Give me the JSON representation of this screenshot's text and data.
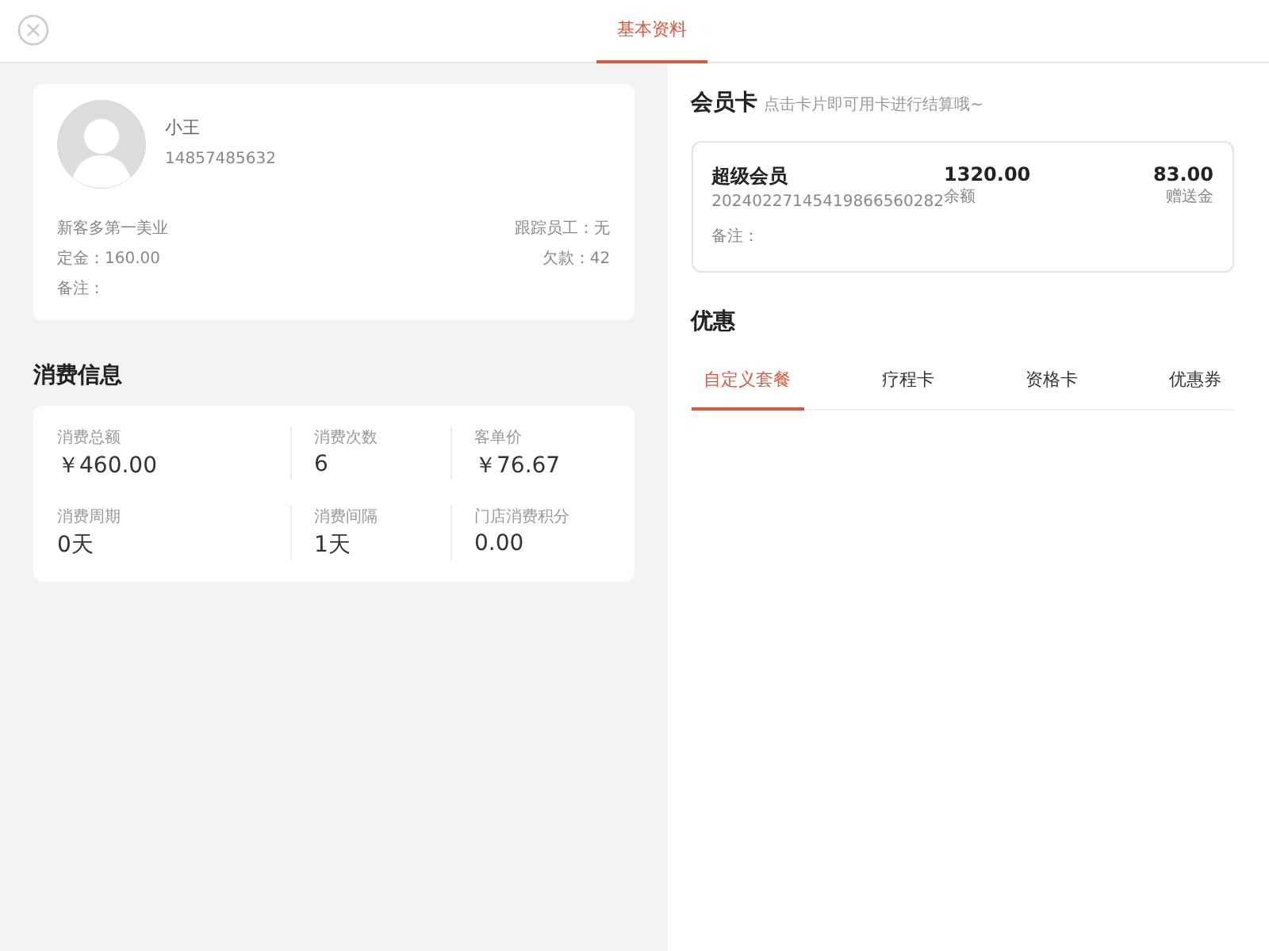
{
  "header": {
    "tabs": [
      {
        "label": "基本资料",
        "selected": true
      }
    ]
  },
  "profile": {
    "name": "小王",
    "phone": "14857485632",
    "store": "新客多第一美业",
    "staff": "跟踪员工：无",
    "deposit": "定金：160.00",
    "debt": "欠款：42",
    "note": "备注："
  },
  "consumption": {
    "title": "消费信息",
    "stats": [
      {
        "label": "消费总额",
        "value": "￥460.00"
      },
      {
        "label": "消费次数",
        "value": "6"
      },
      {
        "label": "客单价",
        "value": "￥76.67"
      },
      {
        "label": "消费周期",
        "value": "0天"
      },
      {
        "label": "消费间隔",
        "value": "1天"
      },
      {
        "label": "门店消费积分",
        "value": "0.00"
      }
    ]
  },
  "member_cards": {
    "title": "会员卡",
    "hint": "点击卡片即可用卡进行结算哦~",
    "cards": [
      {
        "name": "超级会员",
        "number": "20240227145419866560282",
        "note": "备注：",
        "balance": "1320.00",
        "balance_label": "余额",
        "bonus": "83.00",
        "bonus_label": "赠送金"
      }
    ]
  },
  "discounts": {
    "title": "优惠",
    "tabs": [
      {
        "label": "自定义套餐",
        "selected": true
      },
      {
        "label": "疗程卡",
        "selected": false
      },
      {
        "label": "资格卡",
        "selected": false
      },
      {
        "label": "优惠券",
        "selected": false
      }
    ]
  }
}
